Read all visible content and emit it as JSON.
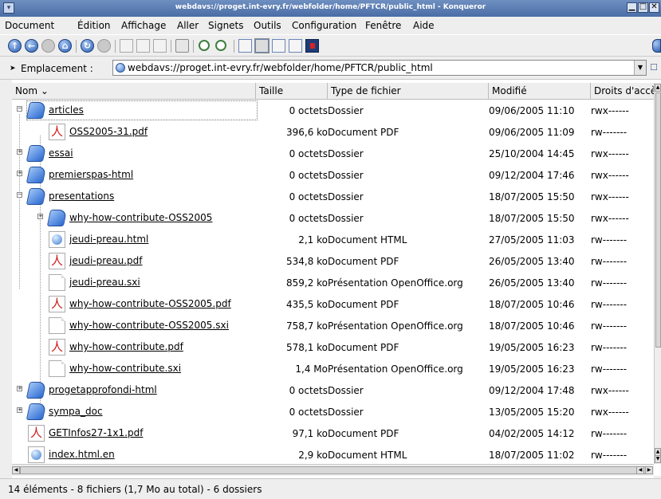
{
  "window": {
    "title": "webdavs://proget.int-evry.fr/webfolder/home/PFTCR/public_html - Konqueror",
    "minimize": "▁",
    "maximize": "□",
    "close": "✕"
  },
  "menu": [
    "Document",
    "Édition",
    "Affichage",
    "Aller",
    "Signets",
    "Outils",
    "Configuration",
    "Fenêtre",
    "Aide"
  ],
  "location": {
    "label": "Emplacement :",
    "url": "webdavs://proget.int-evry.fr/webfolder/home/PFTCR/public_html"
  },
  "columns": {
    "name": "Nom",
    "size": "Taille",
    "type": "Type de fichier",
    "modified": "Modifié",
    "permissions": "Droits d'accès"
  },
  "rows": [
    {
      "name": "articles",
      "size": "0 octets",
      "type": "Dossier",
      "modified": "09/06/2005 11:10",
      "perm": "rwx------",
      "icon": "folder-icon",
      "depth": 0,
      "expander": "−"
    },
    {
      "name": "OSS2005-31.pdf",
      "size": "396,6 ko",
      "type": "Document PDF",
      "modified": "09/06/2005 11:09",
      "perm": "rw-------",
      "icon": "pdf-icon",
      "depth": 1,
      "expander": ""
    },
    {
      "name": "essai",
      "size": "0 octets",
      "type": "Dossier",
      "modified": "25/10/2004 14:45",
      "perm": "rwx------",
      "icon": "folder-icon",
      "depth": 0,
      "expander": "+"
    },
    {
      "name": "premierspas-html",
      "size": "0 octets",
      "type": "Dossier",
      "modified": "09/12/2004 17:46",
      "perm": "rwx------",
      "icon": "folder-icon",
      "depth": 0,
      "expander": "+"
    },
    {
      "name": "presentations",
      "size": "0 octets",
      "type": "Dossier",
      "modified": "18/07/2005 15:50",
      "perm": "rwx------",
      "icon": "folder-icon",
      "depth": 0,
      "expander": "−"
    },
    {
      "name": "why-how-contribute-OSS2005",
      "size": "0 octets",
      "type": "Dossier",
      "modified": "18/07/2005 15:50",
      "perm": "rwx------",
      "icon": "folder-icon",
      "depth": 1,
      "expander": "+"
    },
    {
      "name": "jeudi-preau.html",
      "size": "2,1 ko",
      "type": "Document HTML",
      "modified": "27/05/2005 11:03",
      "perm": "rw-------",
      "icon": "html-icon",
      "depth": 1,
      "expander": ""
    },
    {
      "name": "jeudi-preau.pdf",
      "size": "534,8 ko",
      "type": "Document PDF",
      "modified": "26/05/2005 13:40",
      "perm": "rw-------",
      "icon": "pdf-icon",
      "depth": 1,
      "expander": ""
    },
    {
      "name": "jeudi-preau.sxi",
      "size": "859,2 ko",
      "type": "Présentation OpenOffice.org",
      "modified": "26/05/2005 13:40",
      "perm": "rw-------",
      "icon": "sxi-icon",
      "depth": 1,
      "expander": ""
    },
    {
      "name": "why-how-contribute-OSS2005.pdf",
      "size": "435,5 ko",
      "type": "Document PDF",
      "modified": "18/07/2005 10:46",
      "perm": "rw-------",
      "icon": "pdf-icon",
      "depth": 1,
      "expander": ""
    },
    {
      "name": "why-how-contribute-OSS2005.sxi",
      "size": "758,7 ko",
      "type": "Présentation OpenOffice.org",
      "modified": "18/07/2005 10:46",
      "perm": "rw-------",
      "icon": "sxi-icon",
      "depth": 1,
      "expander": ""
    },
    {
      "name": "why-how-contribute.pdf",
      "size": "578,1 ko",
      "type": "Document PDF",
      "modified": "19/05/2005 16:23",
      "perm": "rw-------",
      "icon": "pdf-icon",
      "depth": 1,
      "expander": ""
    },
    {
      "name": "why-how-contribute.sxi",
      "size": "1,4 Mo",
      "type": "Présentation OpenOffice.org",
      "modified": "19/05/2005 16:23",
      "perm": "rw-------",
      "icon": "sxi-icon",
      "depth": 1,
      "expander": ""
    },
    {
      "name": "progetapprofondi-html",
      "size": "0 octets",
      "type": "Dossier",
      "modified": "09/12/2004 17:48",
      "perm": "rwx------",
      "icon": "folder-icon",
      "depth": 0,
      "expander": "+"
    },
    {
      "name": "sympa_doc",
      "size": "0 octets",
      "type": "Dossier",
      "modified": "13/05/2005 15:20",
      "perm": "rwx------",
      "icon": "folder-icon",
      "depth": 0,
      "expander": "+"
    },
    {
      "name": "GETInfos27-1x1.pdf",
      "size": "97,1 ko",
      "type": "Document PDF",
      "modified": "04/02/2005 14:12",
      "perm": "rw-------",
      "icon": "pdf-icon",
      "depth": 0,
      "expander": ""
    },
    {
      "name": "index.html.en",
      "size": "2,9 ko",
      "type": "Document HTML",
      "modified": "18/07/2005 11:02",
      "perm": "rw-------",
      "icon": "html-icon",
      "depth": 0,
      "expander": ""
    }
  ],
  "status": "14 éléments - 8 fichiers (1,7 Mo au total) - 6 dossiers"
}
